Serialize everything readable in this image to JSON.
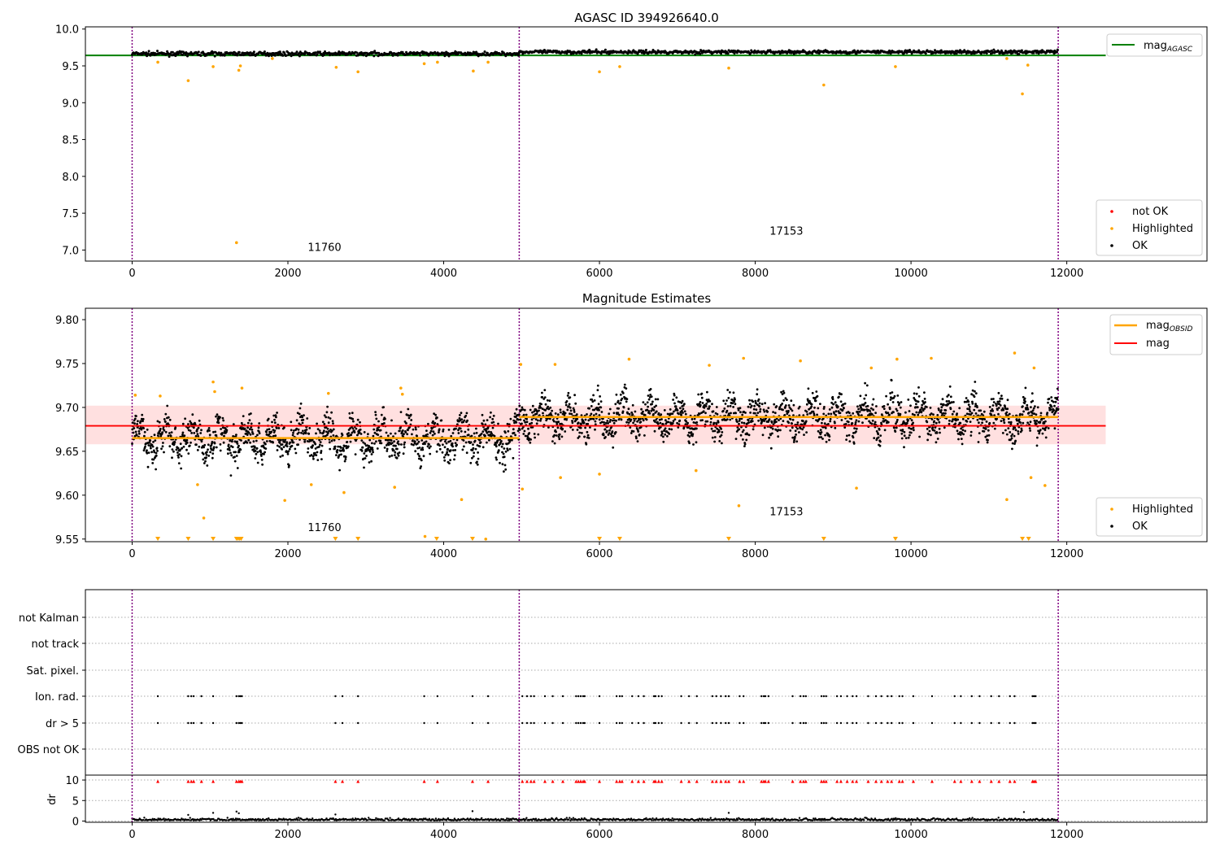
{
  "chart_data": [
    {
      "type": "scatter",
      "title": "AGASC ID 394926640.0",
      "xlim": [
        -600,
        13800
      ],
      "ylim": [
        6.85,
        10.03
      ],
      "xticks": [
        0,
        2000,
        4000,
        6000,
        8000,
        10000,
        12000
      ],
      "xtick_labels": [
        "0",
        "2000",
        "4000",
        "6000",
        "8000",
        "10000",
        "12000"
      ],
      "yticks": [
        7.0,
        7.5,
        8.0,
        8.5,
        9.0,
        9.5,
        10.0
      ],
      "ytick_labels": [
        "7.0",
        "7.5",
        "8.0",
        "8.5",
        "9.0",
        "9.5",
        "10.0"
      ],
      "obsid_boundaries": [
        0,
        4970,
        11890
      ],
      "obsid_labels": [
        {
          "text": "11760",
          "x": 2470,
          "y": 6.99
        },
        {
          "text": "17153",
          "x": 8400,
          "y": 7.21
        }
      ],
      "mag_agasc": {
        "value": 9.642,
        "x_range": [
          -600,
          12500
        ],
        "color": "#008000"
      },
      "segments": [
        {
          "x_start": 0,
          "x_end": 4970,
          "mean": 9.665,
          "sigma": 0.013
        },
        {
          "x_start": 4970,
          "x_end": 11890,
          "mean": 9.688,
          "sigma": 0.012
        }
      ],
      "highlighted_points": [
        [
          720,
          9.3
        ],
        [
          1340,
          7.1
        ],
        [
          1370,
          9.44
        ],
        [
          1390,
          9.5
        ],
        [
          330,
          9.55
        ],
        [
          1040,
          9.49
        ],
        [
          2620,
          9.48
        ],
        [
          2900,
          9.42
        ],
        [
          3750,
          9.53
        ],
        [
          3920,
          9.55
        ],
        [
          4380,
          9.43
        ],
        [
          4570,
          9.55
        ],
        [
          6000,
          9.42
        ],
        [
          6260,
          9.49
        ],
        [
          7660,
          9.47
        ],
        [
          8880,
          9.24
        ],
        [
          9800,
          9.49
        ],
        [
          11430,
          9.12
        ],
        [
          11500,
          9.51
        ],
        [
          11230,
          9.6
        ],
        [
          1800,
          9.6
        ]
      ],
      "legends": [
        {
          "position": "upper right",
          "entries": [
            {
              "label": "mag",
              "sub": "AGASC",
              "color": "#008000",
              "marker": "line"
            }
          ]
        },
        {
          "position": "lower right",
          "entries": [
            {
              "label": "not OK",
              "color": "#ff0000",
              "marker": "dot"
            },
            {
              "label": "Highlighted",
              "color": "#ffa500",
              "marker": "dot"
            },
            {
              "label": "OK",
              "color": "#000000",
              "marker": "dot"
            }
          ]
        }
      ]
    },
    {
      "type": "scatter",
      "title": "Magnitude Estimates",
      "xlim": [
        -600,
        13800
      ],
      "ylim": [
        9.547,
        9.813
      ],
      "xticks": [
        0,
        2000,
        4000,
        6000,
        8000,
        10000,
        12000
      ],
      "xtick_labels": [
        "0",
        "2000",
        "4000",
        "6000",
        "8000",
        "10000",
        "12000"
      ],
      "yticks": [
        9.55,
        9.6,
        9.65,
        9.7,
        9.75,
        9.8
      ],
      "ytick_labels": [
        "9.55",
        "9.60",
        "9.65",
        "9.70",
        "9.75",
        "9.80"
      ],
      "obsid_boundaries": [
        0,
        4970,
        11890
      ],
      "obsid_labels": [
        {
          "text": "11760",
          "x": 2470,
          "y": 9.559
        },
        {
          "text": "17153",
          "x": 8400,
          "y": 9.577
        }
      ],
      "mag": {
        "value": 9.679,
        "band": [
          9.658,
          9.702
        ],
        "x_range": [
          -600,
          12500
        ],
        "color": "#ff0000"
      },
      "mag_obsid": [
        {
          "x_start": 0,
          "x_end": 4970,
          "value": 9.665
        },
        {
          "x_start": 4970,
          "x_end": 11890,
          "value": 9.689
        }
      ],
      "highlighted_points": [
        [
          40,
          9.714
        ],
        [
          360,
          9.713
        ],
        [
          1040,
          9.729
        ],
        [
          1060,
          9.718
        ],
        [
          1410,
          9.722
        ],
        [
          2520,
          9.716
        ],
        [
          3450,
          9.722
        ],
        [
          3470,
          9.715
        ],
        [
          840,
          9.612
        ],
        [
          920,
          9.574
        ],
        [
          1960,
          9.594
        ],
        [
          2300,
          9.612
        ],
        [
          2720,
          9.603
        ],
        [
          3760,
          9.553
        ],
        [
          4230,
          9.595
        ],
        [
          3370,
          9.609
        ],
        [
          5010,
          9.607
        ],
        [
          5500,
          9.62
        ],
        [
          6000,
          9.624
        ],
        [
          7240,
          9.628
        ],
        [
          7790,
          9.588
        ],
        [
          9300,
          9.608
        ],
        [
          11230,
          9.595
        ],
        [
          11540,
          9.62
        ],
        [
          11720,
          9.611
        ],
        [
          6380,
          9.755
        ],
        [
          7850,
          9.756
        ],
        [
          8580,
          9.753
        ],
        [
          9820,
          9.755
        ],
        [
          10260,
          9.756
        ],
        [
          11330,
          9.762
        ],
        [
          5430,
          9.749
        ],
        [
          4990,
          9.749
        ],
        [
          11580,
          9.745
        ],
        [
          7410,
          9.748
        ],
        [
          9490,
          9.745
        ],
        [
          4540,
          9.55
        ]
      ],
      "below_axis_markers": [
        330,
        720,
        1040,
        1340,
        1360,
        1380,
        1400,
        2610,
        2900,
        3910,
        4370,
        6000,
        6260,
        7660,
        8880,
        9800,
        11430,
        11510
      ],
      "legends": [
        {
          "position": "upper right",
          "entries": [
            {
              "label": "mag",
              "sub": "OBSID",
              "color": "#ffa500",
              "marker": "line"
            },
            {
              "label": "mag",
              "color": "#ff0000",
              "marker": "line"
            }
          ]
        },
        {
          "position": "lower right",
          "entries": [
            {
              "label": "Highlighted",
              "color": "#ffa500",
              "marker": "dot"
            },
            {
              "label": "OK",
              "color": "#000000",
              "marker": "dot"
            }
          ]
        }
      ]
    },
    {
      "type": "scatter",
      "xlim": [
        -600,
        13800
      ],
      "xticks": [
        0,
        2000,
        4000,
        6000,
        8000,
        10000,
        12000
      ],
      "xtick_labels": [
        "0",
        "2000",
        "4000",
        "6000",
        "8000",
        "10000",
        "12000"
      ],
      "flag_rows": [
        "not Kalman",
        "not track",
        "Sat. pixel.",
        "Ion. rad.",
        "dr > 5",
        "OBS not OK"
      ],
      "flag_events": [
        330,
        720,
        760,
        790,
        890,
        1040,
        1340,
        1370,
        1390,
        1410,
        2610,
        2700,
        2900,
        3750,
        3920,
        4370,
        4570,
        5010,
        5070,
        5120,
        5160,
        5300,
        5400,
        5530,
        5700,
        5730,
        5760,
        5790,
        5810,
        6000,
        6220,
        6260,
        6290,
        6420,
        6500,
        6570,
        6700,
        6720,
        6760,
        6800,
        7050,
        7150,
        7250,
        7450,
        7500,
        7560,
        7620,
        7660,
        7800,
        7850,
        8080,
        8110,
        8130,
        8170,
        8480,
        8580,
        8620,
        8650,
        8850,
        8880,
        8910,
        9050,
        9100,
        9180,
        9250,
        9300,
        9450,
        9550,
        9620,
        9700,
        9750,
        9850,
        9890,
        10030,
        10270,
        10560,
        10640,
        10780,
        10880,
        11030,
        11130,
        11270,
        11330,
        11560,
        11580,
        11600
      ],
      "dr_ylim": [
        -0.3,
        11.2
      ],
      "dr_yticks": [
        0,
        5,
        10
      ],
      "dr_ytick_labels": [
        "0",
        "5",
        "10"
      ],
      "dr_ylabel": "dr",
      "dr_threshold_markers_y": 9.7,
      "dr_spikes": [
        [
          720,
          1.5
        ],
        [
          1040,
          2.0
        ],
        [
          1340,
          2.3
        ],
        [
          1370,
          1.9
        ],
        [
          2610,
          1.6
        ],
        [
          4370,
          2.4
        ],
        [
          7660,
          2.0
        ],
        [
          11450,
          2.2
        ]
      ]
    }
  ]
}
